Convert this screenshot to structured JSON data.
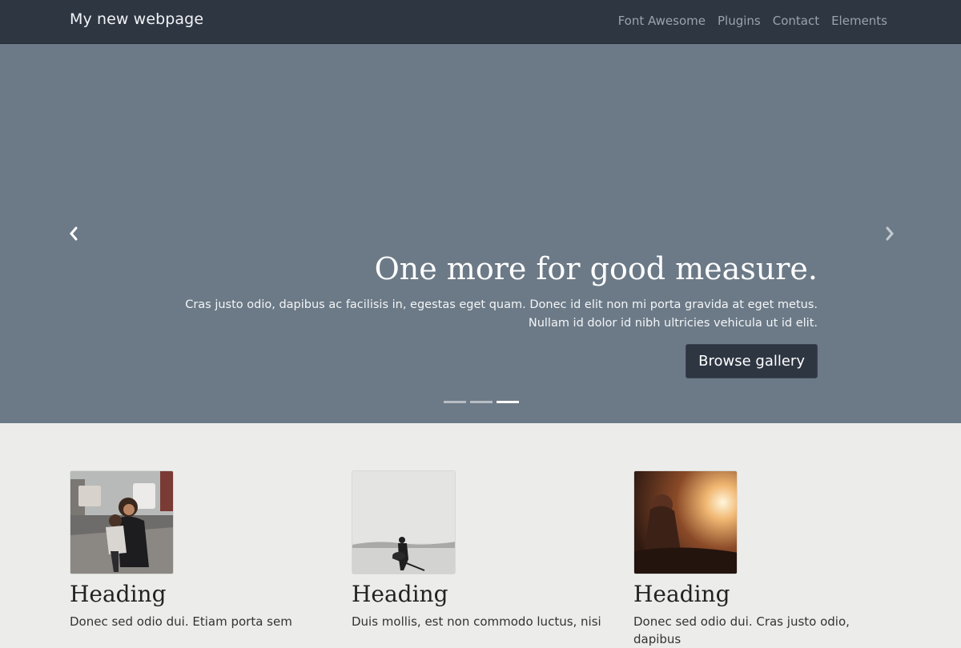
{
  "nav": {
    "brand": "My new webpage",
    "links": [
      "Font Awesome",
      "Plugins",
      "Contact",
      "Elements"
    ]
  },
  "hero": {
    "title": "One more for good measure.",
    "text": "Cras justo odio, dapibus ac facilisis in, egestas eget quam. Donec id elit non mi porta gravida at eget metus. Nullam id dolor id nibh ultricies vehicula ut id elit.",
    "button": "Browse gallery",
    "slides_count": 3,
    "active_slide": 3,
    "prev_icon": "chevron-left-icon",
    "next_icon": "chevron-right-icon"
  },
  "features": [
    {
      "heading": "Heading",
      "text": "Donec sed odio dui. Etiam porta sem"
    },
    {
      "heading": "Heading",
      "text": "Duis mollis, est non commodo luctus, nisi"
    },
    {
      "heading": "Heading",
      "text": "Donec sed odio dui. Cras justo odio, dapibus"
    }
  ],
  "colors": {
    "navbar": "#2e3642",
    "hero_bg": "#6c7a87",
    "page_bg": "#ecedea",
    "button_bg": "#2e3642"
  }
}
